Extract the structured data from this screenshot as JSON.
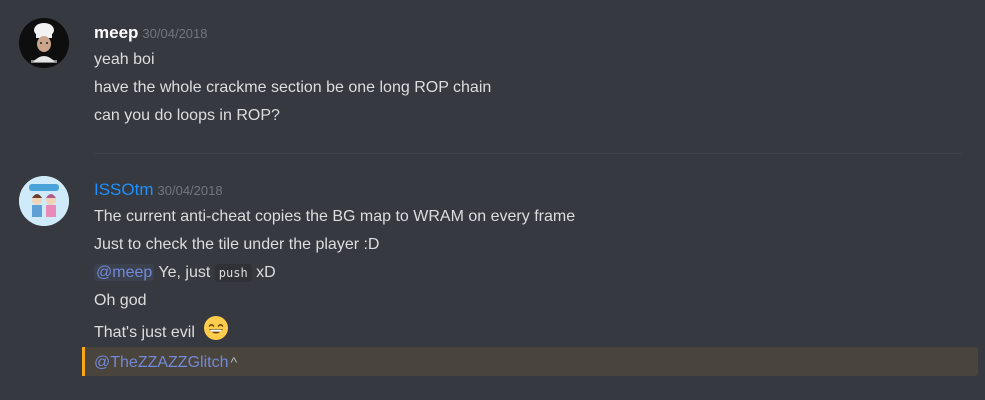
{
  "colors": {
    "background": "#36393f",
    "meep_name": "#ffffff",
    "isso_name": "#1e90ff",
    "mention": "#7289da",
    "highlight_bar": "#faa61a"
  },
  "messages": [
    {
      "username": "meep",
      "timestamp": "30/04/2018",
      "avatar_icon": "chef-avatar-icon",
      "lines": [
        "yeah boi",
        "have the whole crackme section be one long ROP chain",
        "can you do loops in ROP?"
      ]
    },
    {
      "username": "ISSOtm",
      "timestamp": "30/04/2018",
      "avatar_icon": "anime-pair-avatar-icon",
      "lines": [
        "The current anti-cheat copies the BG map to WRAM on every frame",
        "Just to check the tile under the player :D"
      ],
      "reply": {
        "mention": "@meep",
        "text_before": "Ye, just",
        "code": "push",
        "text_after": "xD"
      },
      "line_oh_god": "Oh god",
      "line_evil": "That's just evil",
      "emoji_icon": "grinning-face-emoji-icon"
    }
  ],
  "highlighted": {
    "mention": "@TheZZAZZGlitch",
    "caret": "^"
  }
}
